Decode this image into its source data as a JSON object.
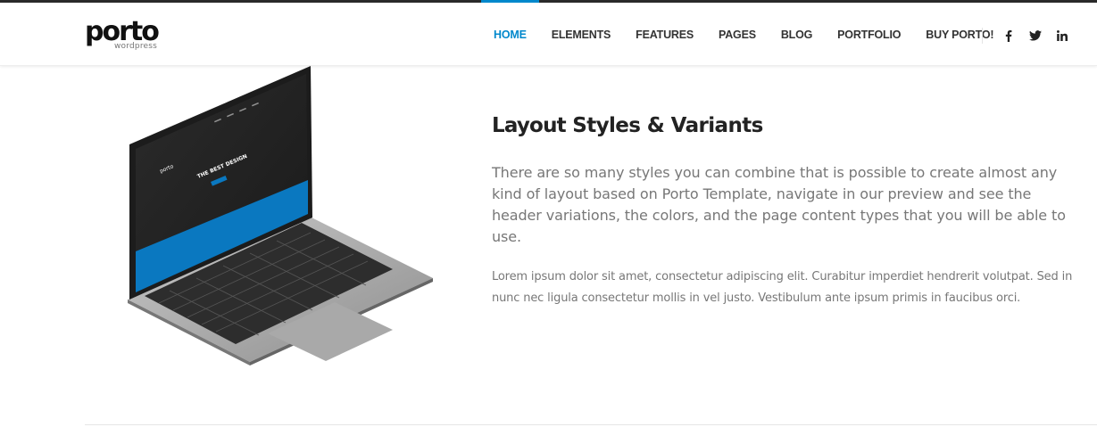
{
  "brand": {
    "name": "porto",
    "sub": "wordpress"
  },
  "nav": {
    "items": [
      {
        "label": "HOME",
        "active": true
      },
      {
        "label": "ELEMENTS",
        "active": false
      },
      {
        "label": "FEATURES",
        "active": false
      },
      {
        "label": "PAGES",
        "active": false
      },
      {
        "label": "BLOG",
        "active": false
      },
      {
        "label": "PORTFOLIO",
        "active": false
      },
      {
        "label": "BUY PORTO!",
        "active": false
      }
    ]
  },
  "social": [
    "facebook-icon",
    "twitter-icon",
    "linkedin-icon"
  ],
  "section": {
    "title_bold": "Layout",
    "title_rest": " Styles & Variants",
    "lead": "There are so many styles you can combine that is possible to create almost any kind of layout based on Porto Template, navigate in our preview and see the header variations, the colors, and the page content types that you will be able to use.",
    "body": "Lorem ipsum dolor sit amet, consectetur adipiscing elit. Curabitur imperdiet hendrerit volutpat. Sed in nunc nec ligula consectetur mollis in vel justo. Vestibulum ante ipsum primis in faucibus orci."
  },
  "laptop_screen": {
    "headline": "THE BEST DESIGN",
    "logo": "porto"
  },
  "colors": {
    "accent": "#0088cc",
    "text": "#777777",
    "heading": "#222222"
  }
}
